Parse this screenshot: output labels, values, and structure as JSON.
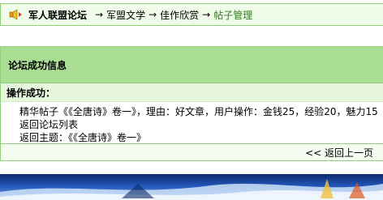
{
  "breadcrumb": {
    "home": "军人联盟论坛",
    "separator": "→",
    "items": [
      "军盟文学",
      "佳作欣赏",
      "帖子管理"
    ]
  },
  "panel": {
    "title": "论坛成功信息",
    "subtitle": "操作成功：",
    "lines": [
      "精华帖子《《全唐诗》卷一》，理由：好文章，用户操作：金钱25，经验20，魅力15",
      "返回论坛列表",
      "返回主题：《《全唐诗》卷一》"
    ],
    "back_link": "<< 返回上一页"
  },
  "colors": {
    "nav_bg": "#f1fbe9",
    "border": "#8ed07a",
    "header_bg": "#a9dd94",
    "current_crumb": "#2e7d1e"
  },
  "icons": {
    "nav": "speaker-arrow-icon"
  }
}
